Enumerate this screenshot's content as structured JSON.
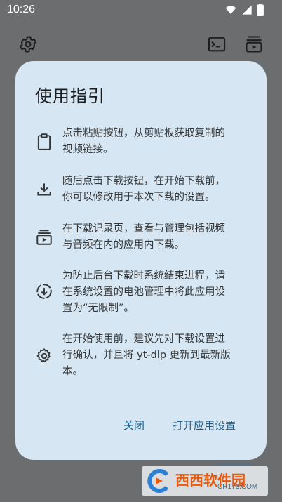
{
  "status_bar": {
    "time": "10:26",
    "icons": [
      "wifi-icon",
      "signal-icon",
      "battery-icon"
    ]
  },
  "app_bar": {
    "icons": [
      "settings-icon",
      "terminal-icon",
      "download-queue-icon"
    ]
  },
  "dialog": {
    "title": "使用指引",
    "items": [
      {
        "icon": "clipboard-icon",
        "line1": "点击粘贴按钮，从剪贴板获取复制的",
        "line2": "视频链接。",
        "line3": ""
      },
      {
        "icon": "download-icon",
        "line1": "随后点击下载按钮，在开始下载前，",
        "line2": "你可以修改用于本次下载的设置。",
        "line3": ""
      },
      {
        "icon": "subscriptions-icon",
        "line1": "在下载记录页，查看与管理包括视频",
        "line2": "与音频在内的应用内下载。",
        "line3": ""
      },
      {
        "icon": "download-circle-icon",
        "line1": "为防止后台下载时系统结束进程，请",
        "line2": "在系统设置的电池管理中将此应用设",
        "line3": "置为“无限制”。"
      },
      {
        "icon": "settings-gear-icon",
        "line1": "在开始使用前，建议先对下载设置进",
        "line2": "行确认，并且将 yt-dlp 更新到最新版",
        "line3": "本。"
      }
    ],
    "actions": {
      "close": "关闭",
      "open_settings": "打开应用设置"
    }
  },
  "watermark": {
    "text": "西西软件园",
    "sub": "CR173.COM"
  },
  "colors": {
    "scrim": "#6b6d6f",
    "dialog_bg": "#d6e6f2",
    "accent": "#1b5f8a",
    "text": "#333537"
  }
}
